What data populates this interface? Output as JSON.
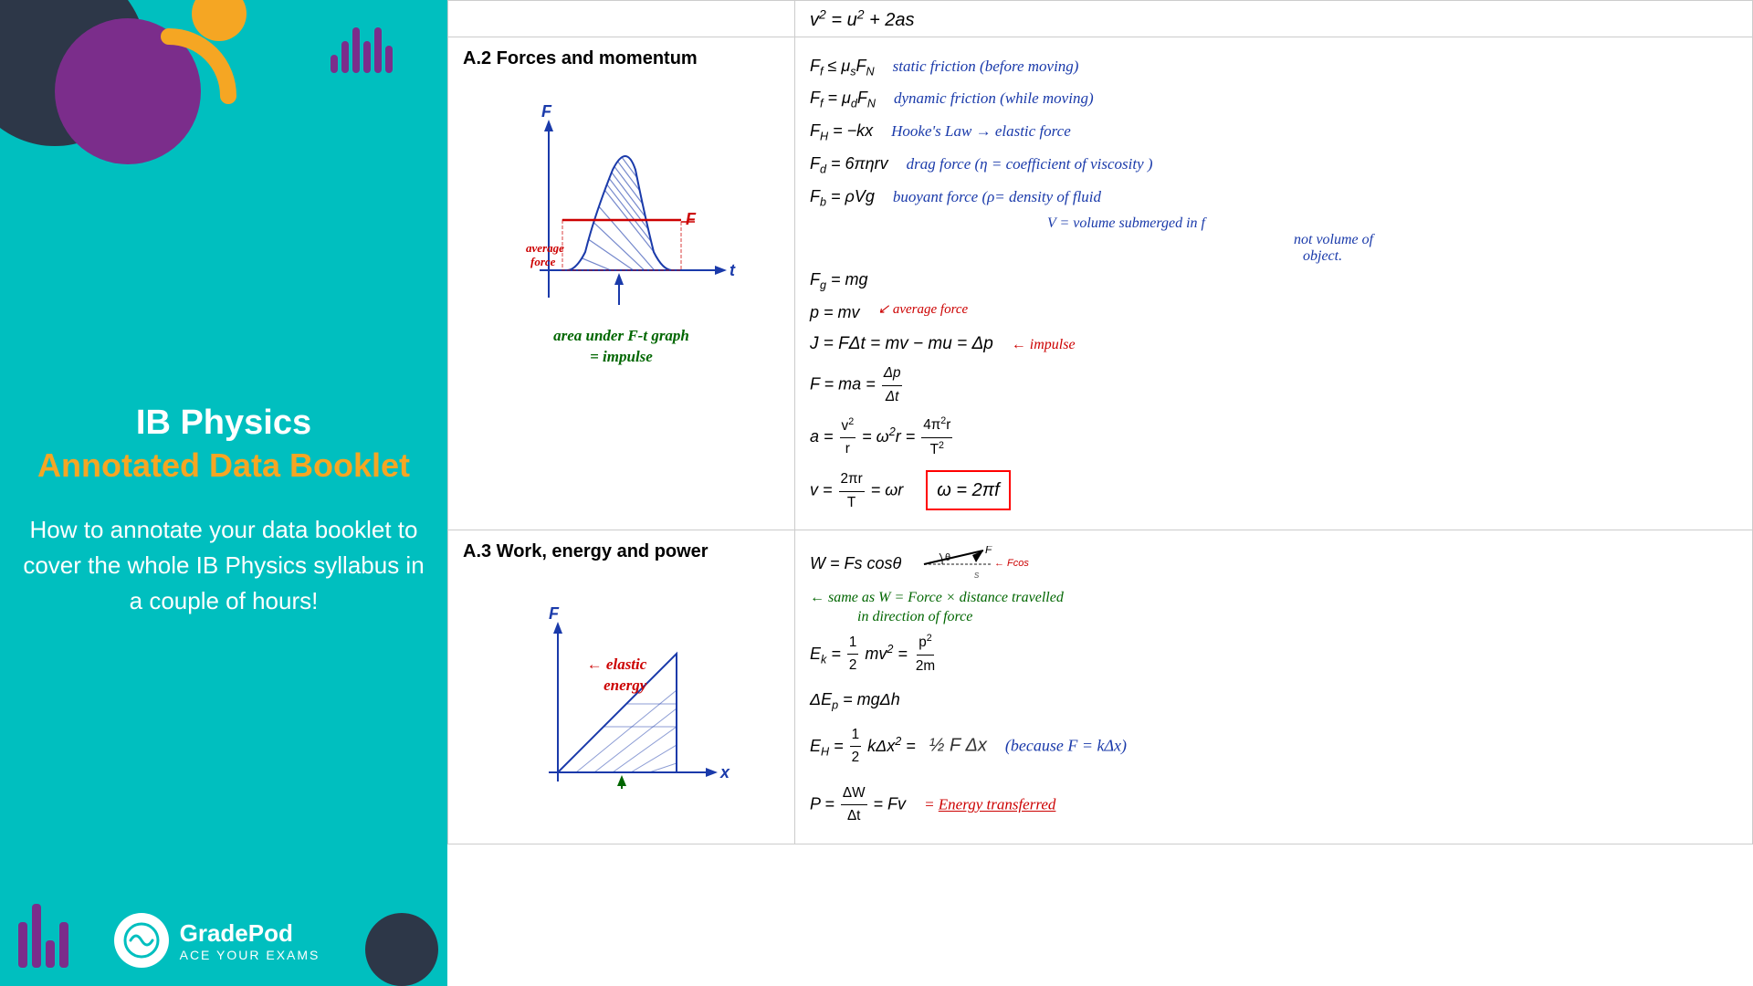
{
  "leftPanel": {
    "title_line1": "IB Physics",
    "title_line2": "Annotated Data Booklet",
    "subtitle": "How to annotate your data booklet to cover the whole IB Physics syllabus in a couple of hours!",
    "logo_name": "GradePod",
    "logo_tagline": "ACE YOUR EXAMS"
  },
  "rightPanel": {
    "topFormula": "v² = u² + 2as",
    "sections": [
      {
        "id": "A2",
        "label": "A.2 Forces and momentum",
        "formulas": [
          "F_f ≤ μ_s F_N",
          "F_f = μ_d F_N",
          "F_H = −kx",
          "F_d = 6πηrv",
          "F_b = ρVg",
          "F_g = mg",
          "p = mv",
          "J = FΔt = mv − mu = Δp",
          "F = ma = Δp/Δt",
          "a = v²/r = ω²r = 4π²r/T²",
          "v = 2πr/T = ωr"
        ],
        "annotations": {
          "static_friction": "static friction (before moving)",
          "dynamic_friction": "dynamic friction (while moving)",
          "hookes_law": "Hooke's Law → elastic force",
          "drag_force": "drag force (η = coefficient of viscosity)",
          "buoyant_force": "buoyant force (ρ = density of fluid",
          "buoyant_note1": "V = volume submerged in f",
          "buoyant_note2": "not volume of",
          "buoyant_note3": "object.",
          "average_force": "average force",
          "impulse_label": "← impulse",
          "average_force_diagram": "average force",
          "area_under": "area under F-t graph",
          "equals_impulse": "= impulse",
          "omega_box": "ω = 2πf"
        }
      },
      {
        "id": "A3",
        "label": "A.3 Work, energy and power",
        "formulas": [
          "W = Fs cosθ",
          "E_k = ½mv² = p²/2m",
          "ΔE_p = mgΔh",
          "E_H = ½kΔx² = ½FΔx",
          "P = ΔW/Δt = Fv"
        ],
        "annotations": {
          "work_note": "same as W = Force × distance travelled in direction of force",
          "elastic_energy": "elastic energy",
          "ek_note": "because F = kΔx",
          "p_label": "energy transferred"
        }
      }
    ]
  }
}
